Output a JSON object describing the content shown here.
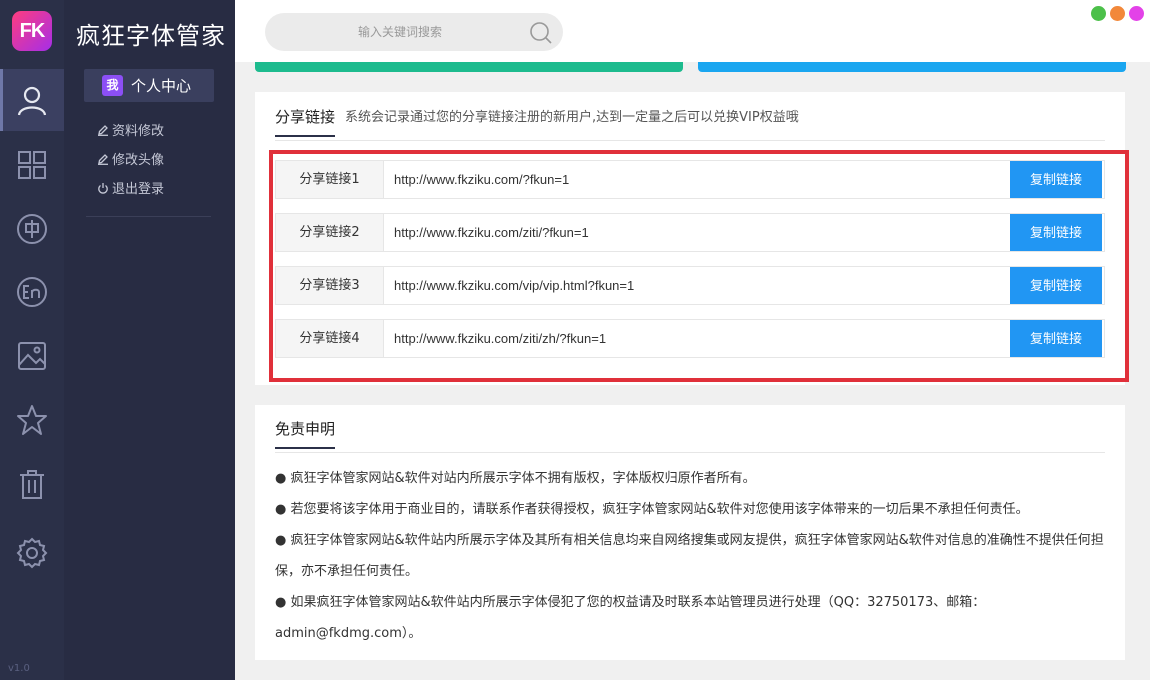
{
  "app": {
    "logo_text": "FK",
    "title": "疯狂字体管家",
    "version": "v1.0"
  },
  "rail": {
    "items": [
      "user-icon",
      "grid-icon",
      "chinese-font-icon",
      "english-font-icon",
      "image-icon",
      "star-icon",
      "trash-icon",
      "settings-icon"
    ],
    "active": "user-icon"
  },
  "subnav": {
    "section_badge": "我",
    "section_label": "个人中心",
    "links": [
      {
        "icon": "pencil-icon",
        "label": "资料修改"
      },
      {
        "icon": "pencil-icon",
        "label": "修改头像"
      },
      {
        "icon": "power-icon",
        "label": "退出登录"
      }
    ]
  },
  "search": {
    "placeholder": "输入关键词搜索"
  },
  "window_controls": {
    "colors": [
      "#4cc04a",
      "#f2883a",
      "#e342e8"
    ]
  },
  "colors": {
    "sidebar": "#2b3048",
    "accent_blue": "#2196f3",
    "accent_green": "#1dbb8e",
    "highlight_red": "#e0303a"
  },
  "share": {
    "tab_label": "分享链接",
    "description": "系统会记录通过您的分享链接注册的新用户,达到一定量之后可以兑换VIP权益哦",
    "rows": [
      {
        "label": "分享链接1",
        "url": "http://www.fkziku.com/?fkun=1",
        "button": "复制链接"
      },
      {
        "label": "分享链接2",
        "url": "http://www.fkziku.com/ziti/?fkun=1",
        "button": "复制链接"
      },
      {
        "label": "分享链接3",
        "url": "http://www.fkziku.com/vip/vip.html?fkun=1",
        "button": "复制链接"
      },
      {
        "label": "分享链接4",
        "url": "http://www.fkziku.com/ziti/zh/?fkun=1",
        "button": "复制链接"
      }
    ]
  },
  "disclaimer": {
    "tab_label": "免责申明",
    "items": [
      "● 疯狂字体管家网站&软件对站内所展示字体不拥有版权，字体版权归原作者所有。",
      "● 若您要将该字体用于商业目的，请联系作者获得授权，疯狂字体管家网站&软件对您使用该字体带来的一切后果不承担任何责任。",
      "● 疯狂字体管家网站&软件站内所展示字体及其所有相关信息均来自网络搜集或网友提供，疯狂字体管家网站&软件对信息的准确性不提供任何担保，亦不承担任何责任。",
      "● 如果疯狂字体管家网站&软件站内所展示字体侵犯了您的权益请及时联系本站管理员进行处理（QQ：32750173、邮箱：admin@fkdmg.com）。"
    ]
  }
}
